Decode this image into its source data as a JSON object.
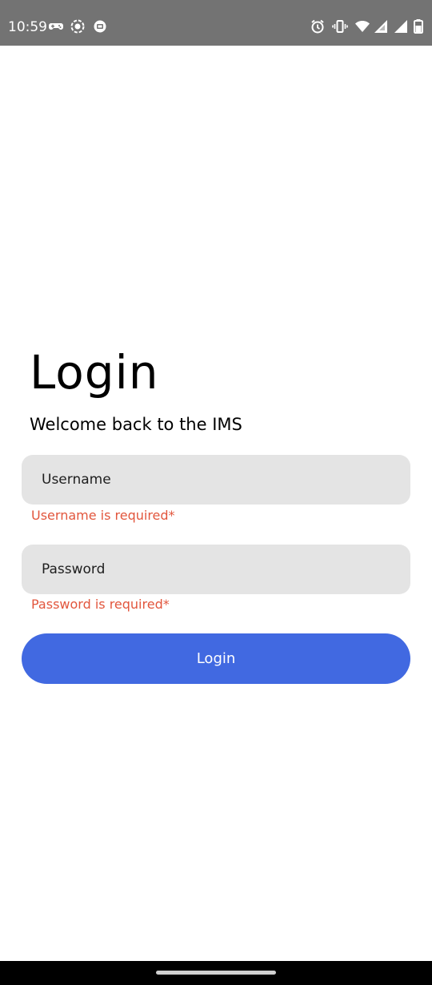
{
  "status_bar": {
    "time": "10:59",
    "left_icons": [
      "game-controller-icon",
      "screen-record-icon",
      "cast-icon"
    ],
    "right_icons": [
      "alarm-icon",
      "vibrate-icon",
      "wifi-icon",
      "signal-icon",
      "signal-icon",
      "battery-icon"
    ],
    "background": "#737373"
  },
  "login": {
    "title": "Login",
    "subtitle": "Welcome back to the IMS",
    "username": {
      "placeholder": "Username",
      "value": "",
      "error": "Username is required*"
    },
    "password": {
      "placeholder": "Password",
      "value": "",
      "error": "Password is required*"
    },
    "submit_label": "Login"
  },
  "colors": {
    "accent": "#4169e1",
    "error": "#e2563d",
    "field_background": "#e4e4e4"
  }
}
